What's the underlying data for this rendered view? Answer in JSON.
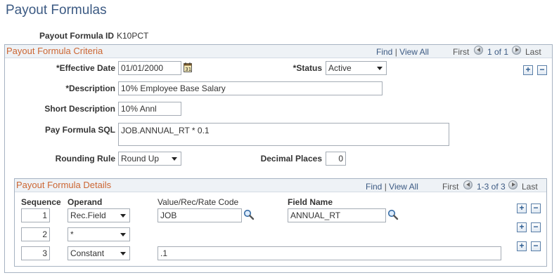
{
  "page": {
    "title": "Payout Formulas"
  },
  "header": {
    "formula_id_label": "Payout Formula ID",
    "formula_id_value": "K10PCT"
  },
  "criteria": {
    "section_title": "Payout Formula Criteria",
    "nav": {
      "find": "Find",
      "sep": "|",
      "view_all": "View All",
      "first": "First",
      "range": "1 of 1",
      "last": "Last"
    },
    "effective_date": {
      "label": "*Effective Date",
      "value": "01/01/2000"
    },
    "status": {
      "label": "*Status",
      "value": "Active"
    },
    "description": {
      "label": "*Description",
      "value": "10% Employee Base Salary"
    },
    "short_description": {
      "label": "Short Description",
      "value": "10% Annl"
    },
    "pay_formula_sql": {
      "label": "Pay Formula SQL",
      "value": "JOB.ANNUAL_RT * 0.1"
    },
    "rounding_rule": {
      "label": "Rounding Rule",
      "value": "Round Up"
    },
    "decimal_places": {
      "label": "Decimal Places",
      "value": "0"
    },
    "add_symbol": "+",
    "remove_symbol": "−"
  },
  "details": {
    "section_title": "Payout Formula Details",
    "nav": {
      "find": "Find",
      "sep": "|",
      "view_all": "View All",
      "first": "First",
      "range": "1-3 of 3",
      "last": "Last"
    },
    "columns": {
      "sequence": "Sequence",
      "operand": "Operand",
      "value_code": "Value/Rec/Rate Code",
      "field_name": "Field Name"
    },
    "rows": [
      {
        "sequence": "1",
        "operand": "Rec.Field",
        "value_code": "JOB",
        "field_name": "ANNUAL_RT"
      },
      {
        "sequence": "2",
        "operand": "*",
        "value_code": "",
        "field_name": ""
      },
      {
        "sequence": "3",
        "operand": "Constant",
        "value_code": ".1",
        "field_name": ""
      }
    ]
  },
  "colors": {
    "title": "#3c5a83",
    "section_title": "#cc6633",
    "link": "#3c5a83",
    "border": "#a7b3c2"
  }
}
